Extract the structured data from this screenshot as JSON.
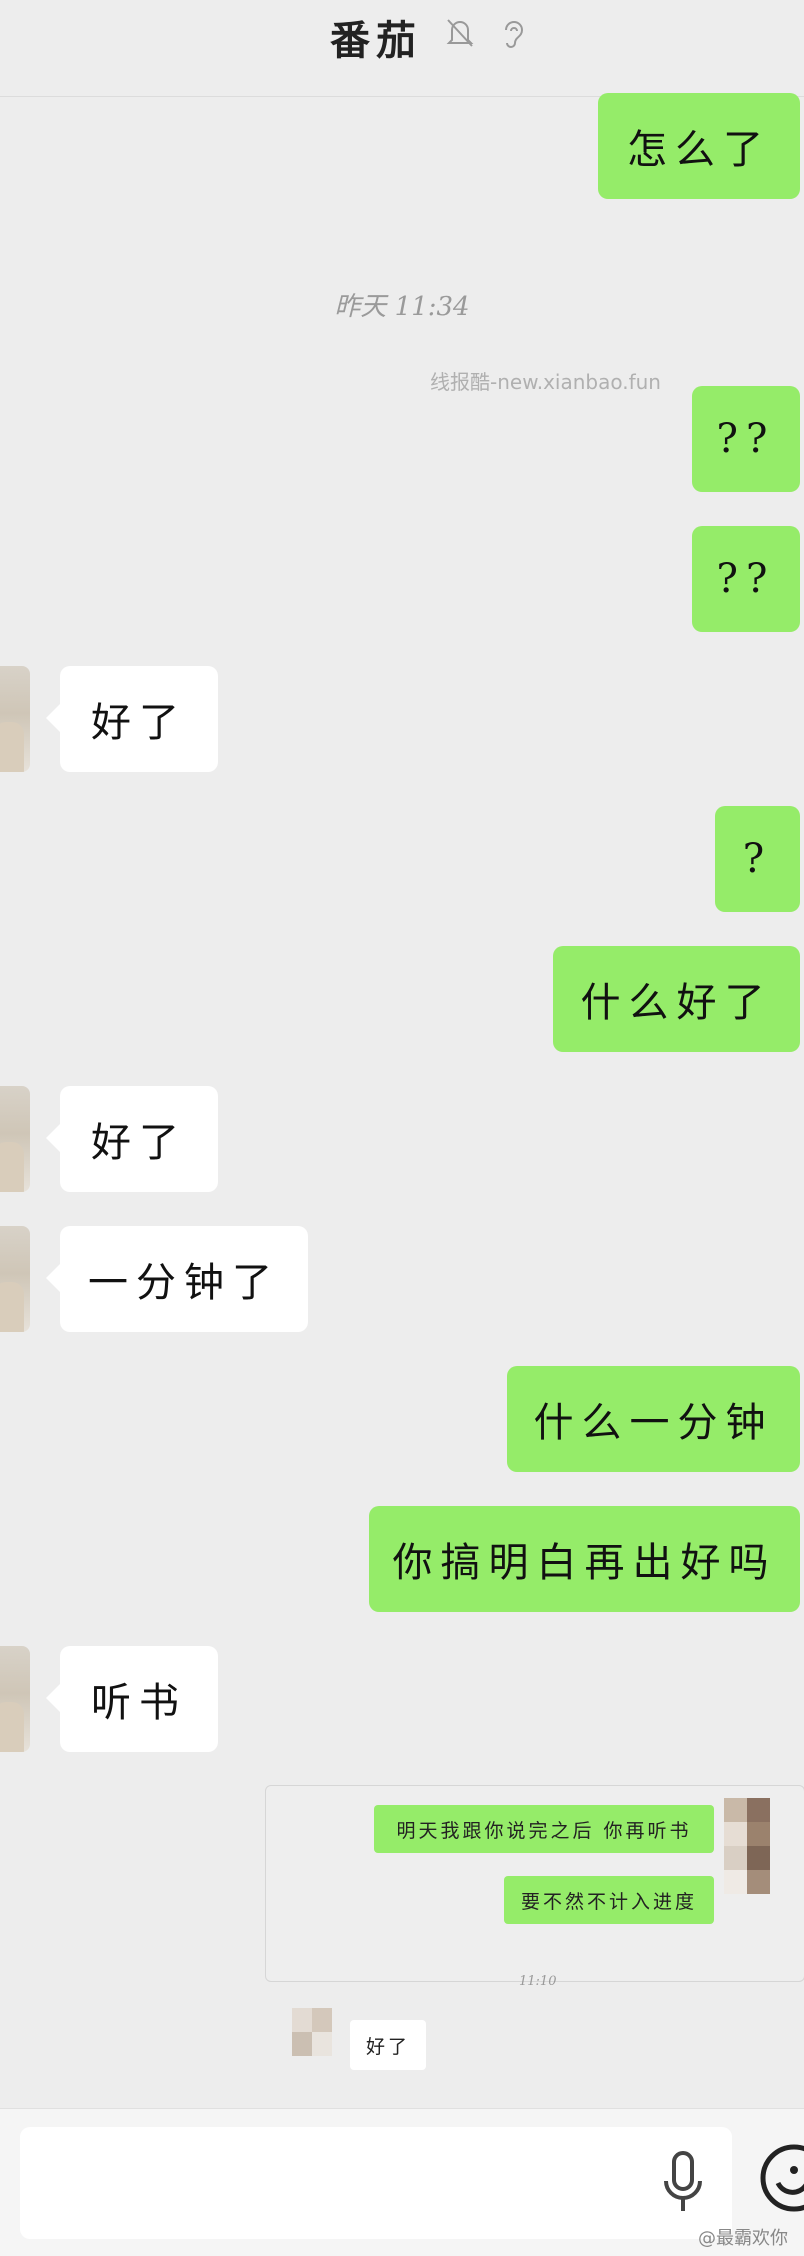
{
  "header": {
    "title": "番茄",
    "icons": [
      "bell-muted-icon",
      "ear-icon"
    ]
  },
  "timestamp": "昨天 11:34",
  "watermark": "线报酷-new.xianbao.fun",
  "messages": [
    {
      "side": "out",
      "text": "怎么了"
    },
    {
      "side": "out",
      "text": "??"
    },
    {
      "side": "out",
      "text": "??"
    },
    {
      "side": "in",
      "text": "好了"
    },
    {
      "side": "out",
      "text": "?"
    },
    {
      "side": "out",
      "text": "什么好了"
    },
    {
      "side": "in",
      "text": "好了"
    },
    {
      "side": "in",
      "text": "一分钟了"
    },
    {
      "side": "out",
      "text": "什么一分钟"
    },
    {
      "side": "out",
      "text": "你搞明白再出好吗"
    },
    {
      "side": "in",
      "text": "听书"
    }
  ],
  "embedded_screenshot": {
    "messages": [
      {
        "side": "out",
        "text": "明天我跟你说完之后 你再听书"
      },
      {
        "side": "out",
        "text": "要不然不计入进度"
      },
      {
        "side": "in",
        "text": "好了"
      }
    ],
    "time": "11:10"
  },
  "footer": {
    "icons": [
      "microphone-icon",
      "emoji-icon"
    ],
    "credit": "@最霸欢你"
  },
  "colors": {
    "outgoing_bubble": "#95ec69",
    "incoming_bubble": "#ffffff",
    "background": "#ededed"
  }
}
